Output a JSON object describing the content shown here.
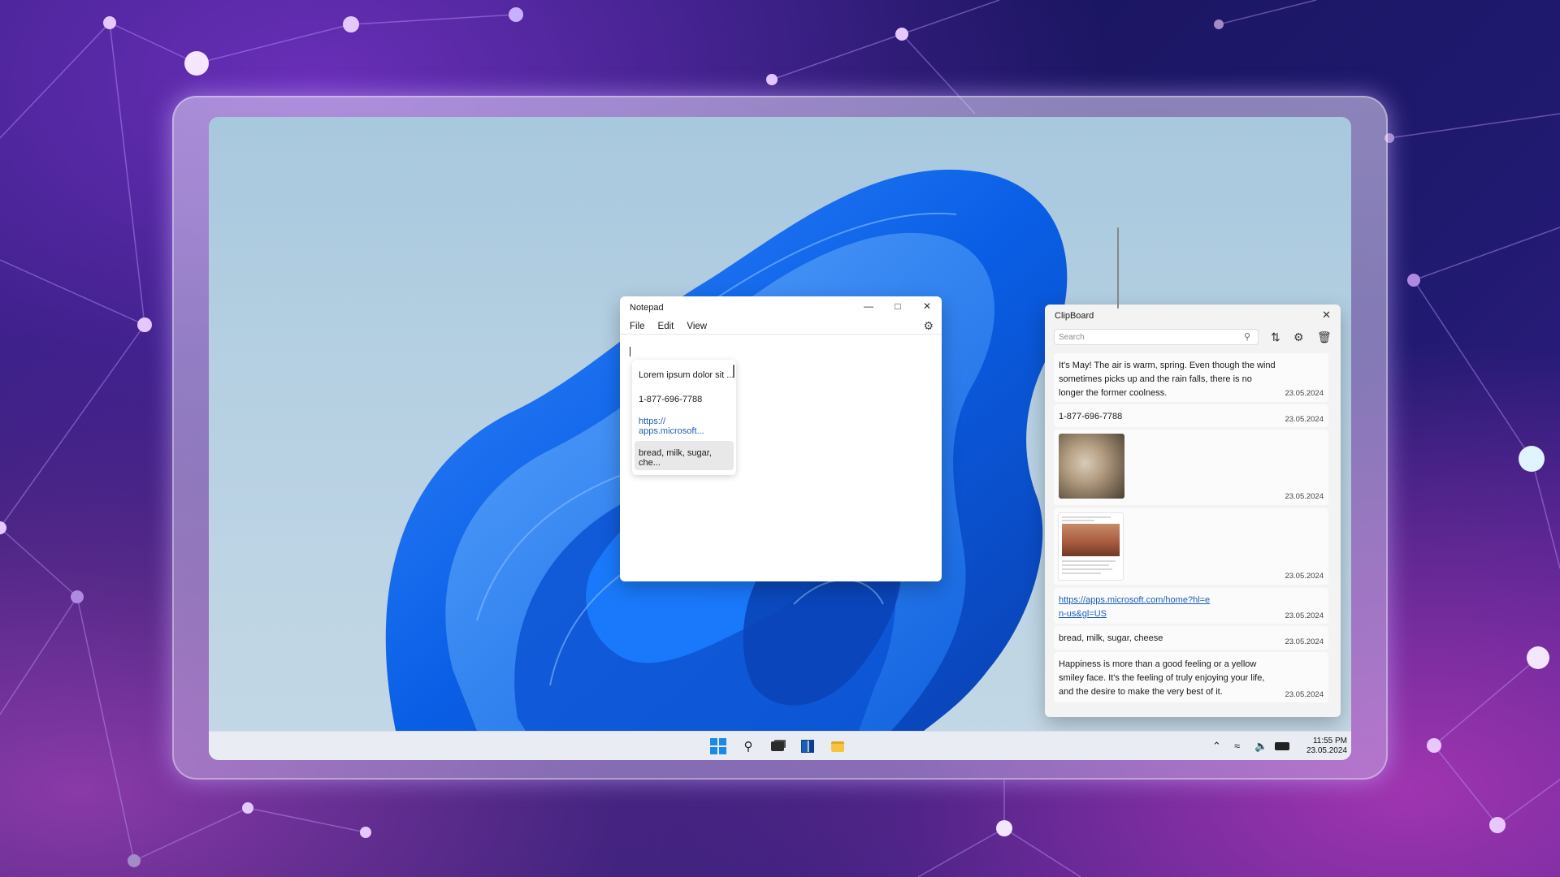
{
  "notepad": {
    "title": "Notepad",
    "menu": [
      "File",
      "Edit",
      "View"
    ],
    "icons": {
      "minimize": "minimize-icon",
      "maximize": "maximize-icon",
      "close": "close-icon",
      "settings": "gear-icon"
    },
    "suggestions": [
      "Lorem ipsum dolor sit ...",
      "1-877-696-7788",
      "https://",
      "apps.microsoft...",
      "bread, milk, sugar,",
      "che..."
    ]
  },
  "clipboard": {
    "title": "ClipBoard",
    "search_placeholder": "Search",
    "icons": {
      "search": "search-icon",
      "sort": "sort-icon",
      "settings": "gear-icon",
      "delete": "trash-icon",
      "close": "close-icon"
    },
    "items": [
      {
        "type": "text",
        "text": "It's May! The air is warm, spring. Even though the wind sometimes picks up and the rain falls, there is no longer the former coolness.",
        "date": "23.05.2024"
      },
      {
        "type": "text",
        "text": "1-877-696-7788",
        "date": "23.05.2024"
      },
      {
        "type": "image",
        "image": "kitten-photo",
        "date": "23.05.2024"
      },
      {
        "type": "image",
        "image": "document-screenshot",
        "date": "23.05.2024"
      },
      {
        "type": "link",
        "text": "https://apps.microsoft.com/home?hl=en-us&gl=US",
        "date": "23.05.2024"
      },
      {
        "type": "text",
        "text": "bread, milk, sugar, cheese",
        "date": "23.05.2024"
      },
      {
        "type": "text",
        "text": "Happiness is more than a good feeling or a yellow smiley face. It's the feeling of truly enjoying your life, and the desire to make the very best of it.",
        "date": "23.05.2024"
      }
    ]
  },
  "taskbar": {
    "apps": [
      "start-icon",
      "search-icon",
      "task-view-icon",
      "widgets-icon",
      "file-explorer-icon"
    ],
    "tray": [
      "chevron-up-icon",
      "wifi-icon",
      "volume-icon",
      "battery-icon"
    ],
    "time": "11:55 PM",
    "date": "23.05.2024"
  }
}
